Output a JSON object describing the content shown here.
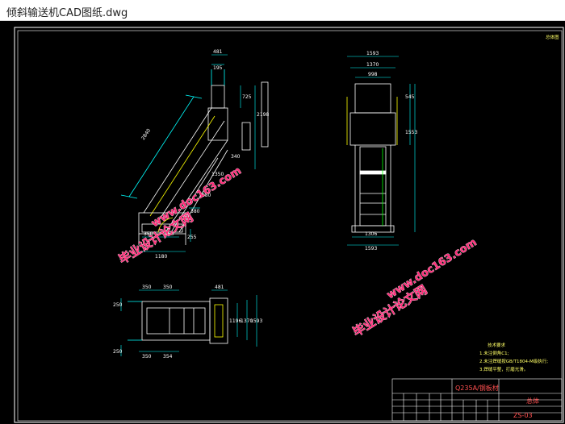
{
  "window": {
    "title": "倾斜输送机CAD图纸.dwg"
  },
  "drawing": {
    "corner_mark": "总体图",
    "side_view": {
      "dims": [
        "481",
        "195",
        "725",
        "2198",
        "2840",
        "340",
        "1350",
        "1880",
        "380",
        "255",
        "350",
        "350",
        "1180"
      ]
    },
    "front_view": {
      "dims": [
        "1593",
        "1370",
        "998",
        "545",
        "1553",
        "1306",
        "1593"
      ]
    },
    "top_view": {
      "dims": [
        "350",
        "350",
        "481",
        "250",
        "1196",
        "1370",
        "1593",
        "250",
        "350",
        "354"
      ]
    },
    "tech_notes": {
      "title": "技术要求",
      "lines": [
        "1.未注倒角C1;",
        "2.未注焊缝按GB/T1804-M级执行;",
        "3.焊缝平整，打磨光滑。"
      ]
    },
    "title_block": {
      "material": "Q235A/钢板材",
      "part_name": "总体",
      "drawing_no": "ZS-03"
    }
  },
  "watermarks": [
    {
      "line1": "毕业设计论文网",
      "line2": "www.doc163.com"
    },
    {
      "line1": "毕业设计论文网",
      "line2": "www.doc163.com"
    }
  ]
}
